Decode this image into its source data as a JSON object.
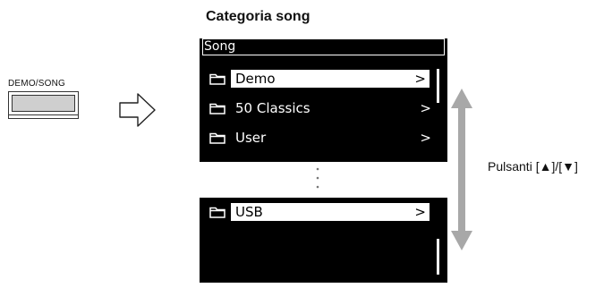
{
  "category_title": "Categoria song",
  "demo_button_label": "DEMO/SONG",
  "screen_top": {
    "header": "Song",
    "rows": [
      {
        "label": "Demo",
        "chevron": ">",
        "selected": true
      },
      {
        "label": "50 Classics",
        "chevron": ">",
        "selected": false
      },
      {
        "label": "User",
        "chevron": ">",
        "selected": false
      }
    ]
  },
  "screen_bottom": {
    "rows": [
      {
        "label": "USB",
        "chevron": ">",
        "selected": true
      }
    ]
  },
  "buttons_label": "Pulsanti [▲]/[▼]",
  "icons": [
    "folder-icon",
    "hollow-right-arrow-icon",
    "double-headed-vertical-arrow-icon",
    "vertical-ellipsis-icon"
  ]
}
